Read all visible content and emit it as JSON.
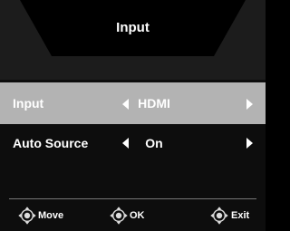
{
  "title": "Input",
  "menu": {
    "rows": [
      {
        "label": "Input",
        "value": "HDMI",
        "selected": true
      },
      {
        "label": "Auto Source",
        "value": "On",
        "selected": false
      }
    ]
  },
  "footer": {
    "move_label": "Move",
    "ok_label": "OK",
    "exit_label": "Exit"
  },
  "colors": {
    "background": "#0d0d0d",
    "header_band": "#1c1c1c",
    "title_panel": "#000000",
    "selected_row": "#b3b3b3",
    "text": "#ffffff"
  },
  "icons": [
    "arrow-left-icon",
    "arrow-right-icon",
    "dpad-icon"
  ]
}
